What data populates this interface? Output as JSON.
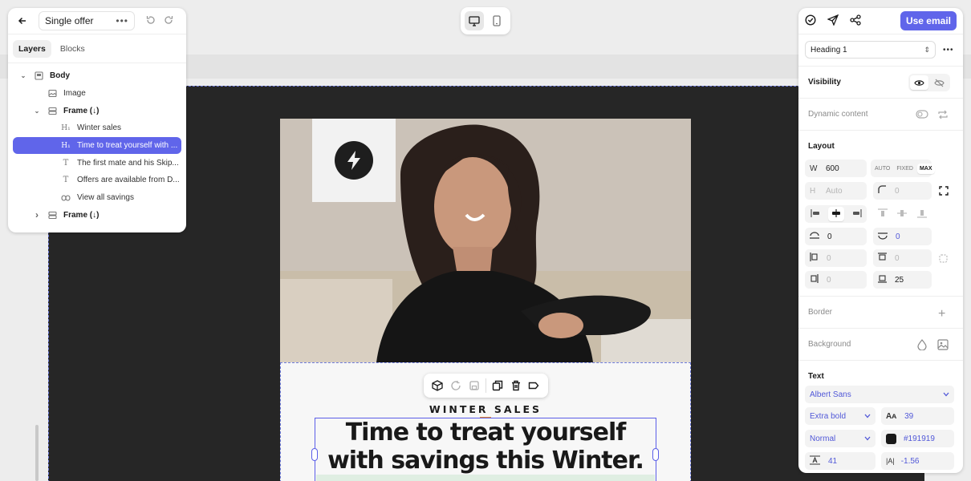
{
  "editor": {
    "document_name": "Single offer",
    "tabs": [
      "Layers",
      "Blocks"
    ],
    "layers": [
      {
        "label": "Body",
        "bold": true,
        "indent": 0,
        "chevron": "down",
        "icon": "frame"
      },
      {
        "label": "Image",
        "bold": false,
        "indent": 1,
        "chevron": "",
        "icon": "image"
      },
      {
        "label": "Frame (↓)",
        "bold": true,
        "indent": 1,
        "chevron": "down",
        "icon": "stack"
      },
      {
        "label": "Winter sales",
        "bold": false,
        "indent": 2,
        "chevron": "",
        "icon": "heading"
      },
      {
        "label": "Time to treat yourself with ...",
        "bold": false,
        "indent": 2,
        "chevron": "",
        "icon": "heading",
        "selected": true
      },
      {
        "label": "The first mate and his Skip...",
        "bold": false,
        "indent": 2,
        "chevron": "",
        "icon": "text"
      },
      {
        "label": "Offers are available from D...",
        "bold": false,
        "indent": 2,
        "chevron": "",
        "icon": "text"
      },
      {
        "label": "View all savings",
        "bold": false,
        "indent": 2,
        "chevron": "",
        "icon": "link"
      },
      {
        "label": "Frame (↓)",
        "bold": true,
        "indent": 1,
        "chevron": "right",
        "icon": "stack"
      }
    ]
  },
  "canvas": {
    "eyebrow": "WINTER SALES",
    "heading": "Time to treat yourself with savings this Winter."
  },
  "inspector": {
    "use_email_label": "Use email",
    "element_type": "Heading 1",
    "visibility_label": "Visibility",
    "dynamic_content_label": "Dynamic content",
    "layout_label": "Layout",
    "width_label": "W",
    "width_value": "600",
    "width_modes": [
      "AUTO",
      "FIXED",
      "MAX"
    ],
    "width_mode_active": "MAX",
    "height_label": "H",
    "height_value": "Auto",
    "radius_value": "0",
    "spacing": {
      "padding_top": "0",
      "gap": "0",
      "left": "0",
      "top": "0",
      "right": "0",
      "bottom": "25"
    },
    "border_label": "Border",
    "background_label": "Background",
    "text_label": "Text",
    "font_family": "Albert Sans",
    "font_weight": "Extra bold",
    "font_size": "39",
    "font_style": "Normal",
    "text_color": "#191919",
    "line_height": "41",
    "letter_spacing": "-1.56"
  },
  "colors": {
    "accent": "#6065ea",
    "selection": "#5b5ee8",
    "orange": "#e8862a"
  }
}
